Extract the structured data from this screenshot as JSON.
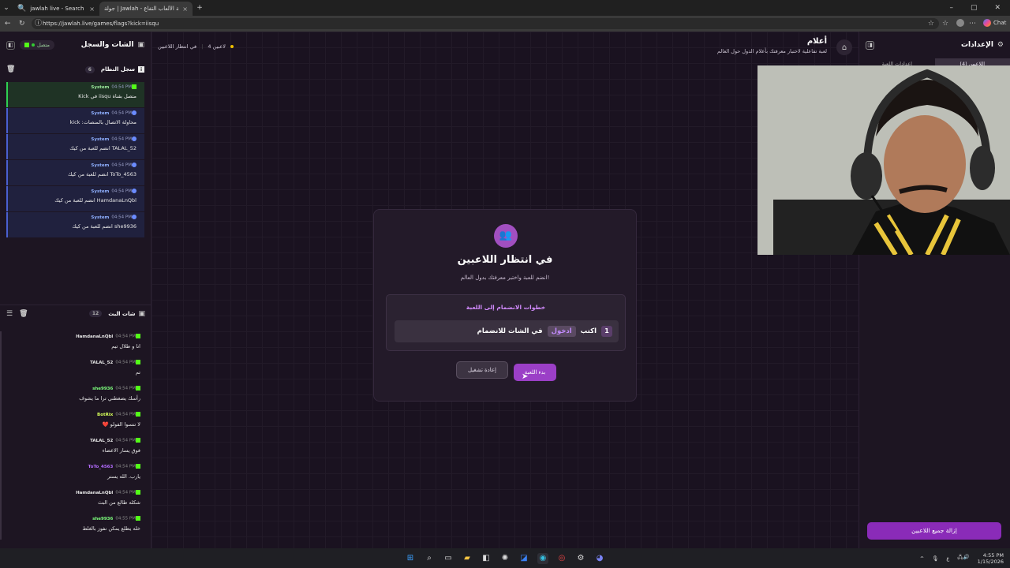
{
  "browser": {
    "tabs": [
      {
        "label": "jawlah live - Search"
      },
      {
        "label": "جولة | Jawlah - منصة الألعاب التفاع..."
      }
    ],
    "url": "https://jawlah.live/games/flags?kick=iisqu",
    "chat_label": "Chat"
  },
  "left_panel": {
    "title": "الشات والسجل",
    "status": "متصل",
    "system_log": {
      "title": "سجل النظام",
      "count": "6",
      "items": [
        {
          "author": "System",
          "time": "04:54 PM",
          "text": "متصل بقناة iisqu في Kick",
          "kind": "success"
        },
        {
          "author": "System",
          "time": "04:54 PM",
          "text": "محاولة الاتصال بالمنصات: kick",
          "kind": "info"
        },
        {
          "author": "System",
          "time": "04:54 PM",
          "text": "TALAL_52 انضم للعبة من كيك",
          "kind": "info"
        },
        {
          "author": "System",
          "time": "04:54 PM",
          "text": "ToTo_4563 انضم للعبة من كيك",
          "kind": "info"
        },
        {
          "author": "System",
          "time": "04:54 PM",
          "text": "HamdanaLnQbl انضم للعبة من كيك",
          "kind": "info"
        },
        {
          "author": "System",
          "time": "04:54 PM",
          "text": "she9936 انضم للعبة من كيك",
          "kind": "info"
        }
      ]
    },
    "live_chat": {
      "title": "شات البث",
      "count": "12",
      "items": [
        {
          "author": "HamdanaLnQbl",
          "time": "04:54 PM",
          "text": "انا و طلال تيم",
          "color": "#e8e8e8"
        },
        {
          "author": "TALAL_52",
          "time": "04:54 PM",
          "text": "تم",
          "color": "#e8e8e8"
        },
        {
          "author": "she9936",
          "time": "04:54 PM",
          "text": "رأسك يضغطني ترا ما يشوف",
          "color": "#7dff7d"
        },
        {
          "author": "BotRix",
          "time": "04:54 PM",
          "text": "لا تنسوا الفولو ❤️",
          "color": "#d6ff5a"
        },
        {
          "author": "TALAL_52",
          "time": "04:54 PM",
          "text": "فوق يسار الاعضاء",
          "color": "#e8e8e8"
        },
        {
          "author": "ToTo_4563",
          "time": "04:54 PM",
          "text": "يارب. الله يستر",
          "color": "#b46cff"
        },
        {
          "author": "HamdanaLnQbl",
          "time": "04:54 PM",
          "text": "شكله طالع من البث",
          "color": "#e8e8e8"
        },
        {
          "author": "she9936",
          "time": "04:55 PM",
          "text": "خله يطلع يمكن نفوز بالغلط",
          "color": "#7dff7d"
        }
      ]
    }
  },
  "main": {
    "game_title": "أعلام",
    "game_subtitle": "لعبة تفاعلية لاختبار معرفتك بأعلام الدول حول العالم",
    "players_count": "4 لاعبين",
    "state_label": "في انتظار اللاعبين",
    "card": {
      "title": "في انتظار اللاعبين",
      "subtitle": "انضم للعبة واختبر معرفتك بدول العالم!",
      "steps_title": "خطوات الانضمام إلى اللعبة",
      "step_number": "1",
      "step_prefix": "اكتب",
      "step_keyword": "ادخول",
      "step_suffix": "في الشات للانضمام",
      "reset_label": "إعادة تشغيل",
      "start_label": "بدء اللعبة"
    }
  },
  "right_panel": {
    "title": "الإعدادات",
    "tab_players": "اللاعبين (4)",
    "tab_settings": "إعدادات اللعبة",
    "clear_label": "إزالة جميع اللاعبين"
  },
  "taskbar": {
    "time": "4:55 PM",
    "date": "1/15/2026",
    "lang": "ع"
  }
}
